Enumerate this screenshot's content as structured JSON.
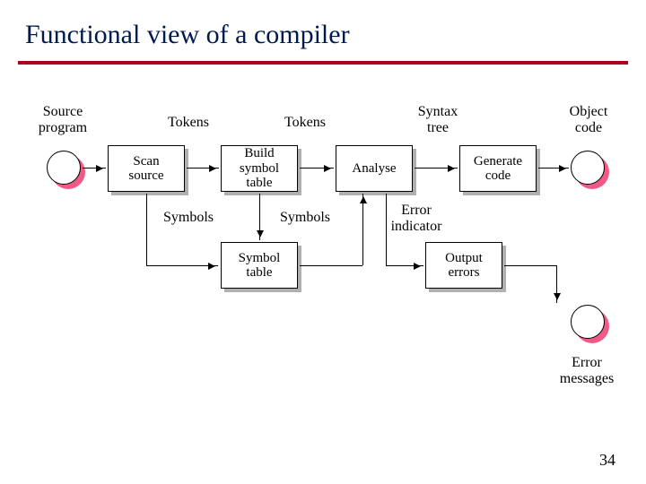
{
  "title": "Functional view of a compiler",
  "page_number": "34",
  "labels": {
    "source_program": "Source\nprogram",
    "tokens1": "Tokens",
    "tokens2": "Tokens",
    "syntax_tree": "Syntax\ntree",
    "object_code": "Object\ncode",
    "symbols1": "Symbols",
    "symbols2": "Symbols",
    "error_indicator": "Error\nindicator",
    "error_messages": "Error\nmessages"
  },
  "processes": {
    "scan_source": "Scan\nsource",
    "build_symbol_table": "Build\nsymbol\ntable",
    "analyse": "Analyse",
    "generate_code": "Generate\ncode",
    "symbol_table": "Symbol\ntable",
    "output_errors": "Output\nerrors"
  }
}
